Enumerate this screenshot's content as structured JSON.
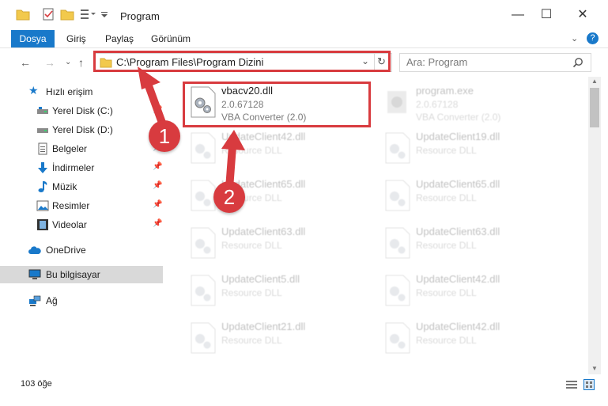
{
  "window": {
    "title": "Program",
    "minimize": "—",
    "maximize": "☐",
    "close": "✕"
  },
  "ribbon": {
    "tabs": [
      "Dosya",
      "Giriş",
      "Paylaş",
      "Görünüm"
    ],
    "help": "?"
  },
  "address": {
    "path": "C:\\Program Files\\Program Dizini"
  },
  "search": {
    "placeholder": "Ara: Program"
  },
  "sidebar": {
    "items": [
      {
        "label": "Hızlı erişim",
        "icon": "star-icon"
      },
      {
        "label": "Yerel Disk (C:)",
        "icon": "drive-icon"
      },
      {
        "label": "Yerel Disk (D:)",
        "icon": "drive-icon"
      },
      {
        "label": "Belgeler",
        "icon": "documents-icon"
      },
      {
        "label": "İndirmeler",
        "icon": "download-icon"
      },
      {
        "label": "Müzik",
        "icon": "music-icon"
      },
      {
        "label": "Resimler",
        "icon": "pictures-icon"
      },
      {
        "label": "Videolar",
        "icon": "videos-icon"
      },
      {
        "label": "OneDrive",
        "icon": "cloud-icon"
      },
      {
        "label": "Bu bilgisayar",
        "icon": "computer-icon"
      },
      {
        "label": "Ağ",
        "icon": "network-icon"
      }
    ]
  },
  "files": [
    {
      "name": "vbacv20.dll",
      "line2": "2.0.67128",
      "line3": "VBA Converter (2.0)"
    },
    {
      "name": "program.exe",
      "line2": "2.0.67128",
      "line3": "VBA Converter (2.0)"
    },
    {
      "name": "UpdateClient42.dll",
      "line2": "Resource DLL"
    },
    {
      "name": "UpdateClient19.dll",
      "line2": "Resource DLL"
    },
    {
      "name": "UpdateClient65.dll",
      "line2": "Resource DLL"
    },
    {
      "name": "UpdateClient65.dll",
      "line2": "Resource DLL"
    },
    {
      "name": "UpdateClient63.dll",
      "line2": "Resource DLL"
    },
    {
      "name": "UpdateClient63.dll",
      "line2": "Resource DLL"
    },
    {
      "name": "UpdateClient5.dll",
      "line2": "Resource DLL"
    },
    {
      "name": "UpdateClient42.dll",
      "line2": "Resource DLL"
    },
    {
      "name": "UpdateClient21.dll",
      "line2": "Resource DLL"
    },
    {
      "name": "UpdateClient42.dll",
      "line2": "Resource DLL"
    }
  ],
  "status": {
    "count": "103 öğe"
  },
  "annotations": {
    "step1": "1",
    "step2": "2",
    "color": "#d83b3f"
  },
  "colors": {
    "accent": "#1979ca",
    "folder": "#f2c94c"
  }
}
